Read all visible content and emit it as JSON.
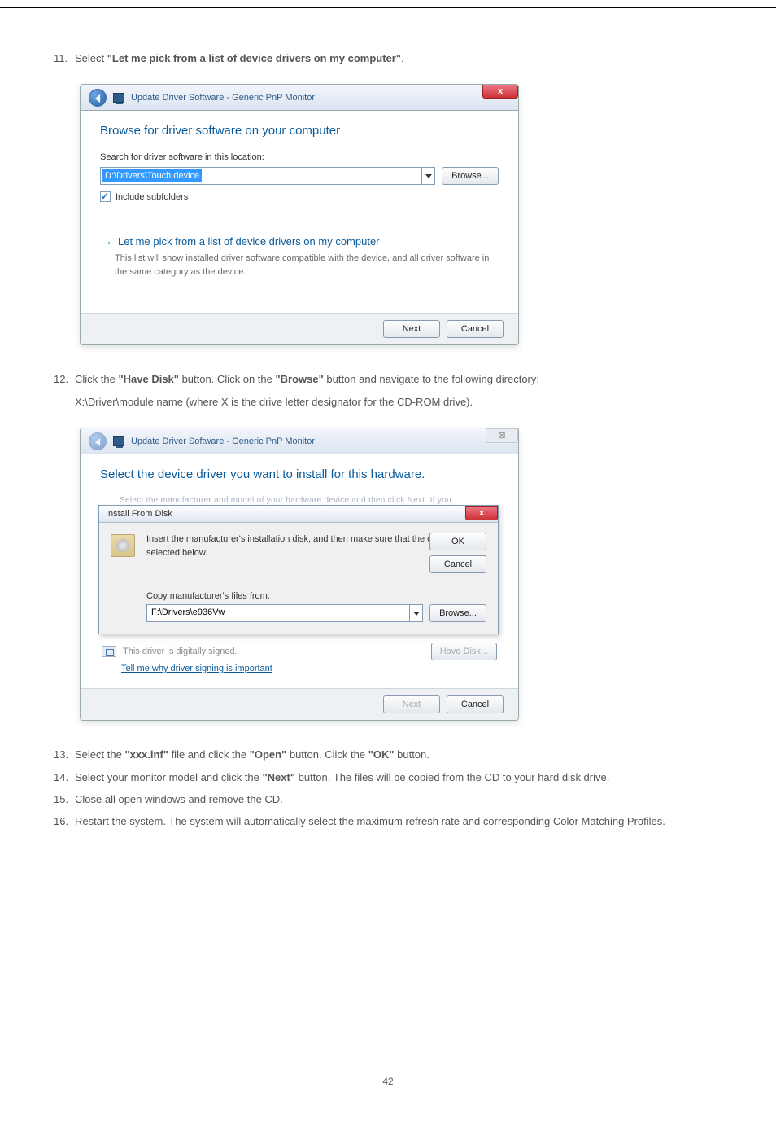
{
  "step11": {
    "select_prefix": "Select ",
    "select_option": "\"Let me pick from a list of device drivers on my computer\"",
    "select_suffix": "."
  },
  "win1": {
    "title": "Update Driver Software - Generic PnP Monitor",
    "close": "x",
    "heading": "Browse for driver software on your computer",
    "search_label": "Search for driver software in this location:",
    "path_value": "D:\\Drivers\\Touch device",
    "browse_btn": "Browse...",
    "include_subfolders": "Include subfolders",
    "link_head": "Let me pick from a list of device drivers on my computer",
    "link_sub": "This list will show installed driver software compatible with the device, and all driver software in the same category as the device.",
    "arrow": "→",
    "next_btn": "Next",
    "cancel_btn": "Cancel"
  },
  "step12": {
    "part_a": "Click the ",
    "bold_a": "\"Have Disk\"",
    "part_b": " button. Click on the ",
    "bold_b": "\"Browse\"",
    "part_c": " button and navigate to the following directory:",
    "subline": "X:\\Driver\\module name (where X is the drive letter designator for the CD-ROM drive)."
  },
  "win2": {
    "title": "Update Driver Software - Generic PnP Monitor",
    "frame_close": "⊠",
    "heading": "Select the device driver you want to install for this hardware.",
    "blurred_hint": "Select the manufacturer and model of your hardware device and then click Next. If you",
    "subdlg_title": "Install From Disk",
    "close": "x",
    "disk_text": "Insert the manufacturer's installation disk, and then make sure that the correct drive is selected below.",
    "ok_btn": "OK",
    "cancel_btn": "Cancel",
    "copy_label": "Copy manufacturer's files from:",
    "path_value": "F:\\Drivers\\e936Vw",
    "browse_btn": "Browse...",
    "signed_text": "This driver is digitally signed.",
    "have_disk_btn": "Have Disk...",
    "tell_link": "Tell me why driver signing is important",
    "next_btn": "Next",
    "foot_cancel_btn": "Cancel"
  },
  "step13": {
    "a": "Select the ",
    "b": "\"xxx.inf\"",
    "c": " file and click the ",
    "d": "\"Open\"",
    "e": " button. Click the ",
    "f": "\"OK\"",
    "g": " button."
  },
  "step14": {
    "a": "Select your monitor model and click the ",
    "b": "\"Next\"",
    "c": " button. The files will be copied from the CD to your hard disk drive."
  },
  "step15": {
    "a": "Close all open windows and remove the CD."
  },
  "step16": {
    "a": "Restart the system. The system will automatically select the maximum refresh rate and corresponding Color Matching Profiles."
  },
  "page_number": "42"
}
